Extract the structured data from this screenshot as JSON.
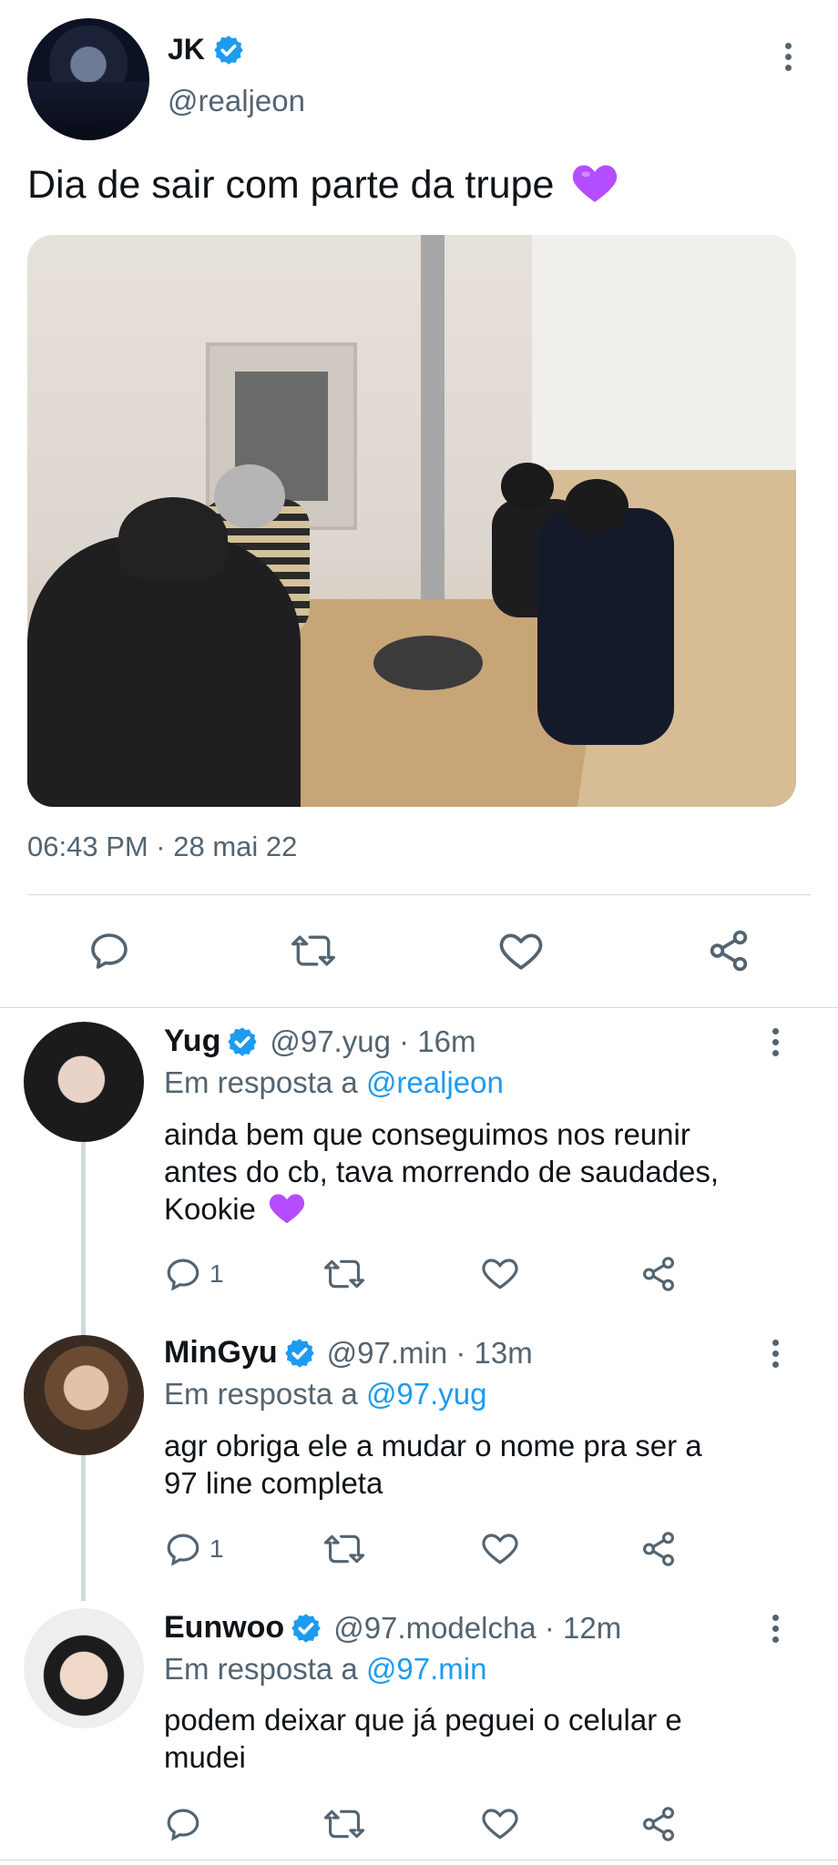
{
  "tweet": {
    "author_name": "JK",
    "author_handle": "@realjeon",
    "text": "Dia de sair com parte da trupe",
    "emoji": "purple-heart",
    "timestamp": "06:43 PM · 28 mai 22"
  },
  "replies": [
    {
      "name": "Yug",
      "handle": "@97.yug · 16m",
      "reply_prefix": "Em resposta a",
      "reply_to": "@realjeon",
      "text_lines": [
        "ainda bem que conseguimos nos reunir",
        "antes do cb, tava morrendo de saudades,",
        "Kookie"
      ],
      "reply_count": "1"
    },
    {
      "name": "MinGyu",
      "handle": "@97.min · 13m",
      "reply_prefix": "Em resposta a",
      "reply_to": "@97.yug",
      "text_lines": [
        "agr obriga ele a mudar o nome pra ser a",
        "97 line completa"
      ],
      "reply_count": "1"
    },
    {
      "name": "Eunwoo",
      "handle": "@97.modelcha · 12m",
      "reply_prefix": "Em resposta a",
      "reply_to": "@97.min",
      "text_lines": [
        "podem deixar que já peguei o celular e",
        "mudei"
      ],
      "reply_count": ""
    }
  ],
  "colors": {
    "accent": "#1d9bf0",
    "secondary_text": "#536471",
    "emoji_heart": "#b44dff"
  }
}
